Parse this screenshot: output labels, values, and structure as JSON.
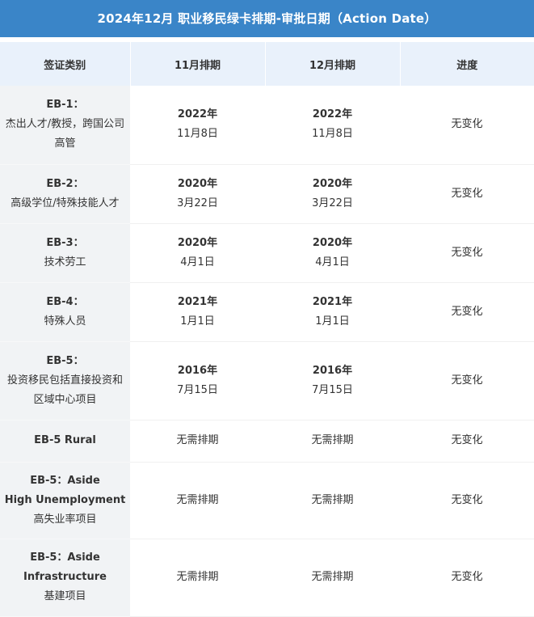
{
  "title": "2024年12月 职业移民绿卡排期-审批日期（Action Date）",
  "headers": [
    "签证类别",
    "11月排期",
    "12月排期",
    "进度"
  ],
  "rows": [
    {
      "cat": [
        "EB-1：",
        "杰出人才/教授，跨国公司",
        "高管"
      ],
      "nov": [
        "2022年",
        "11月8日"
      ],
      "dec": [
        "2022年",
        "11月8日"
      ],
      "progress": "无变化"
    },
    {
      "cat": [
        "EB-2：",
        "高级学位/特殊技能人才"
      ],
      "nov": [
        "2020年",
        "3月22日"
      ],
      "dec": [
        "2020年",
        "3月22日"
      ],
      "progress": "无变化"
    },
    {
      "cat": [
        "EB-3：",
        "技术劳工"
      ],
      "nov": [
        "2020年",
        "4月1日"
      ],
      "dec": [
        "2020年",
        "4月1日"
      ],
      "progress": "无变化"
    },
    {
      "cat": [
        "EB-4：",
        "特殊人员"
      ],
      "nov": [
        "2021年",
        "1月1日"
      ],
      "dec": [
        "2021年",
        "1月1日"
      ],
      "progress": "无变化"
    },
    {
      "cat": [
        "EB-5：",
        "投资移民包括直接投资和",
        "区域中心项目"
      ],
      "nov": [
        "2016年",
        "7月15日"
      ],
      "dec": [
        "2016年",
        "7月15日"
      ],
      "progress": "无变化"
    },
    {
      "cat": [
        "EB-5 Rural"
      ],
      "nov": [
        "无需排期"
      ],
      "dec": [
        "无需排期"
      ],
      "progress": "无变化"
    },
    {
      "cat": [
        "EB-5：Aside",
        "High Unemployment",
        "高失业率项目"
      ],
      "nov": [
        "无需排期"
      ],
      "dec": [
        "无需排期"
      ],
      "progress": "无变化"
    },
    {
      "cat": [
        "EB-5：Aside",
        "Infrastructure",
        "基建项目"
      ],
      "nov": [
        "无需排期"
      ],
      "dec": [
        "无需排期"
      ],
      "progress": "无变化"
    }
  ]
}
